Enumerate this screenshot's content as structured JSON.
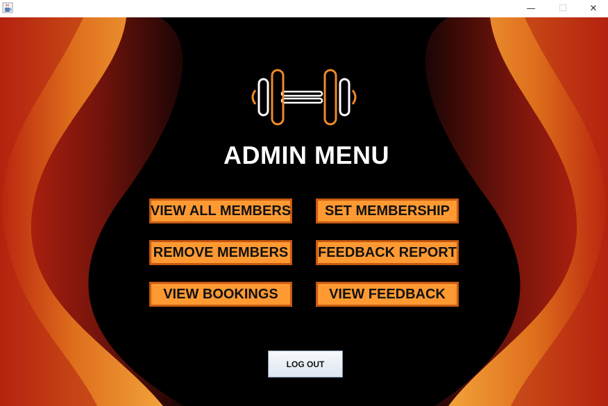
{
  "window": {
    "controls": {
      "minimize": "—",
      "maximize": "☐",
      "close": "✕"
    }
  },
  "header": {
    "title": "ADMIN MENU"
  },
  "menu": {
    "view_all_members": "VIEW ALL MEMBERS",
    "set_membership": "SET MEMBERSHIP",
    "remove_members": "REMOVE MEMBERS",
    "feedback_report": "FEEDBACK REPORT",
    "view_bookings": "VIEW BOOKINGS",
    "view_feedback": "VIEW FEEDBACK"
  },
  "logout": {
    "label": "LOG OUT"
  },
  "icons": {
    "app": "java-coffee-icon",
    "logo": "dumbbell-icon"
  },
  "colors": {
    "button_fill": "#ff9a33",
    "button_border": "#c85a12",
    "background": "#000000",
    "accent_red": "#b51f12",
    "accent_orange": "#f0a040"
  }
}
